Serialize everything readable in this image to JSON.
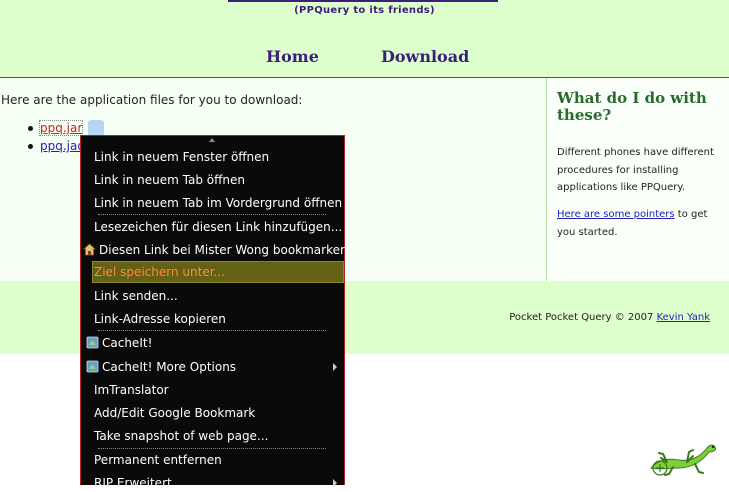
{
  "header": {
    "subtitle": "(PPQuery to its friends)",
    "nav": [
      "Home",
      "Download"
    ]
  },
  "main": {
    "intro": "Here are the application files for you to download:",
    "files": [
      "ppq.jar",
      "ppq.jad"
    ]
  },
  "sidebar": {
    "heading": "What do I do with these?",
    "paragraph": "Different phones have different procedures for installing applications like PPQuery.",
    "link": "Here are some pointers",
    "link_suffix": " to get you started."
  },
  "footer": {
    "text": "Pocket Pocket Query © 2007 ",
    "author_link": "Kevin Yank"
  },
  "context_menu": {
    "items": [
      {
        "label": "Link in neuem Fenster öffnen",
        "icon": null
      },
      {
        "label": "Link in neuem Tab öffnen",
        "icon": null
      },
      {
        "label": "Link in neuem Tab im Vordergrund öffnen",
        "icon": null
      },
      {
        "label": "Lesezeichen für diesen Link hinzufügen...",
        "icon": null
      },
      {
        "label": "Diesen Link bei Mister Wong bookmarken",
        "icon": "mister-wong-icon"
      },
      {
        "label": "Ziel speichern unter...",
        "icon": null,
        "selected": true
      },
      {
        "label": "Link senden...",
        "icon": null
      },
      {
        "label": "Link-Adresse kopieren",
        "icon": null
      },
      {
        "label": "CacheIt!",
        "icon": "cacheit-icon"
      },
      {
        "label": "CacheIt! More Options",
        "icon": "cacheit-icon",
        "submenu": true
      },
      {
        "label": "ImTranslator",
        "icon": null
      },
      {
        "label": "Add/Edit Google Bookmark",
        "icon": null
      },
      {
        "label": "Take snapshot of web page...",
        "icon": null
      },
      {
        "label": "Permanent entfernen",
        "icon": null
      },
      {
        "label": "RIP Erweitert",
        "icon": null,
        "submenu": true
      }
    ]
  },
  "colors": {
    "header_bg": "#ddffcc",
    "nav": "#3c1f7a",
    "menu_bg": "#0a0a0a",
    "menu_selected_bg": "#646014",
    "menu_selected_text": "#ff8a3a",
    "link": "#2222bb"
  }
}
